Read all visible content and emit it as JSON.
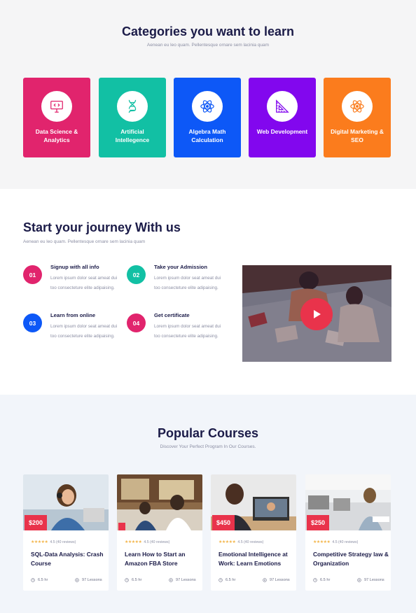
{
  "categories_section": {
    "title": "Categories you want to learn",
    "subtitle": "Aenean eu leo quam. Pellentesque ornare sem lacinia quam",
    "items": [
      {
        "label": "Data Science & Analytics",
        "color": "#e1246d",
        "icon": "monitor-code-icon"
      },
      {
        "label": "Artificial Intellegence",
        "color": "#12c0a4",
        "icon": "dna-icon"
      },
      {
        "label": "Algebra Math Calculation",
        "color": "#0d58f7",
        "icon": "atom-icon"
      },
      {
        "label": "Web Development",
        "color": "#8207ee",
        "icon": "ruler-triangle-icon"
      },
      {
        "label": "Digital Marketing & SEO",
        "color": "#fb7c1d",
        "icon": "atom-icon"
      }
    ]
  },
  "journey_section": {
    "title": "Start your journey With us",
    "subtitle": "Aenean eu leo quam. Pellentesque ornare sem lacinia quam",
    "steps": [
      {
        "num": "01",
        "title": "Signup with all info",
        "text": "Lorem ipsum dolor seat ameat dui too consecteture elite adipaising.",
        "color": "#e1246d"
      },
      {
        "num": "02",
        "title": "Take your Admission",
        "text": "Lorem ipsum dolor seat ameat dui too consecteture elite adipaising.",
        "color": "#12c0a4"
      },
      {
        "num": "03",
        "title": "Learn from online",
        "text": "Lorem ipsum dolor seat ameat dui too consecteture elite adipaising.",
        "color": "#0d58f7"
      },
      {
        "num": "04",
        "title": "Get certificate",
        "text": "Lorem ipsum dolor seat ameat dui too consecteture elite adipaising.",
        "color": "#e1246d"
      }
    ],
    "video": {
      "play_icon": "play-icon"
    }
  },
  "courses_section": {
    "title": "Popular Courses",
    "subtitle": "Discover Your Perfect Program In Our Courses.",
    "courses": [
      {
        "price": "$200",
        "rating": "4.5 (40 reviews)",
        "title": "SQL-Data Analysis: Crash Course",
        "hours": "6.5 hr",
        "lessons": "97 Lessons"
      },
      {
        "price": "",
        "rating": "4.5 (40 reviews)",
        "title": "Learn How to Start an Amazon FBA Store",
        "hours": "6.5 hr",
        "lessons": "97 Lessons"
      },
      {
        "price": "$450",
        "rating": "4.5 (40 reviews)",
        "title": "Emotional Intelligence at Work: Learn Emotions",
        "hours": "6.5 hr",
        "lessons": "97 Lessons"
      },
      {
        "price": "$250",
        "rating": "4.5 (40 reviews)",
        "title": "Competitive Strategy law & Organization",
        "hours": "6.5 hr",
        "lessons": "97 Lessons"
      }
    ]
  }
}
